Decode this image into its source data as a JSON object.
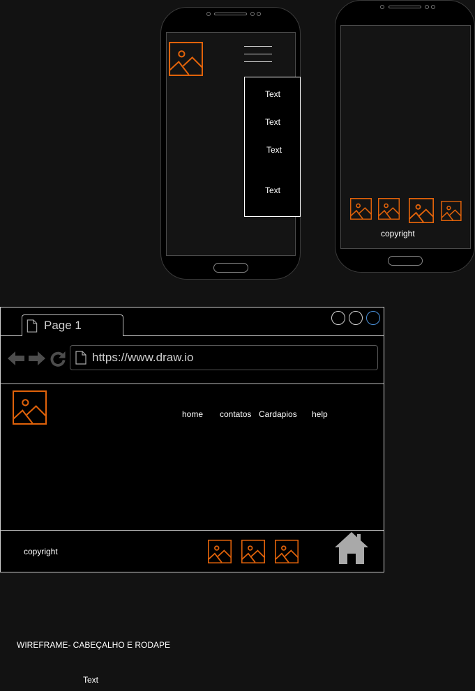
{
  "mobile_menu": {
    "items": [
      "Text",
      "Text",
      "Text",
      "Text"
    ]
  },
  "mobile_footer": {
    "copyright": "copyright"
  },
  "browser": {
    "tab_label": "Page 1",
    "url": "https://www.draw.io",
    "nav": [
      "home",
      "contatos",
      "Cardapios",
      "help"
    ],
    "footer_copyright": "copyright"
  },
  "caption": {
    "title": "WIREFRAME- CABEÇALHO E RODAPE",
    "text": "Text"
  },
  "colors": {
    "accent": "#e0620a",
    "background": "#121212",
    "window_button_active": "#4a90d9"
  },
  "icons": [
    "image-icon",
    "hamburger-menu-icon",
    "page-icon",
    "back-arrow-icon",
    "forward-arrow-icon",
    "refresh-icon",
    "home-icon"
  ]
}
